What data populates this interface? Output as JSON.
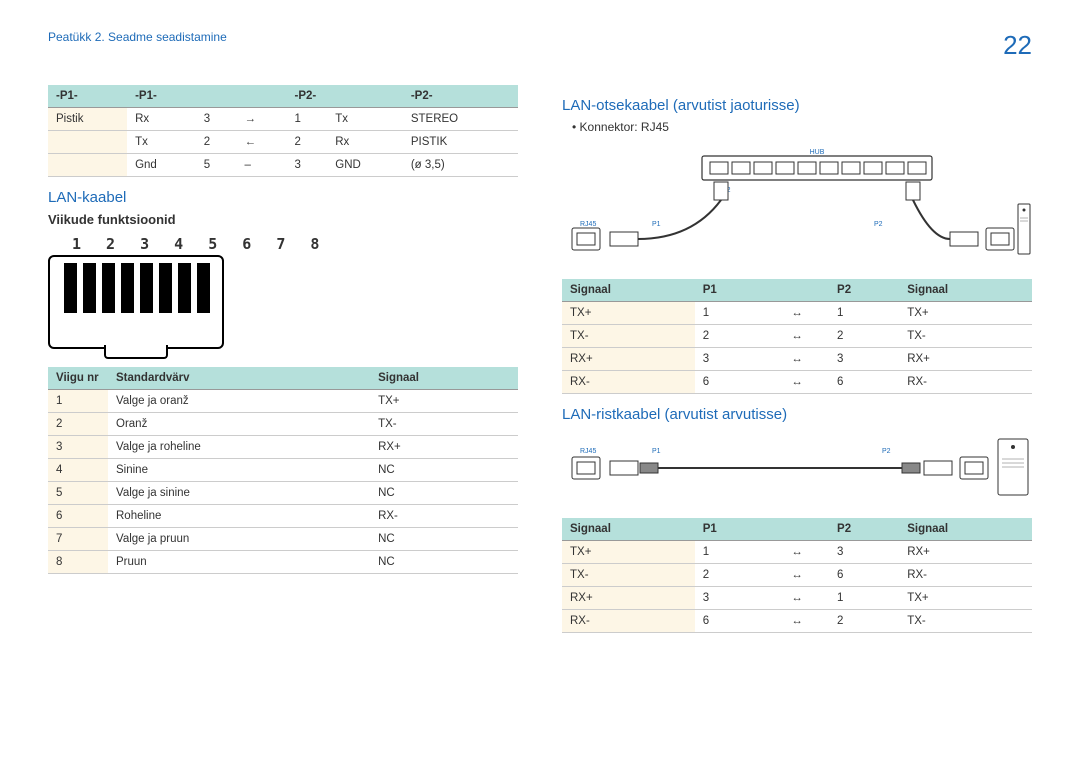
{
  "header": {
    "chapter": "Peatükk 2. Seadme seadistamine",
    "page": "22"
  },
  "left": {
    "table_p1p2": {
      "headers": [
        "-P1-",
        "-P1-",
        "",
        "",
        "-P2-",
        "-P2-"
      ],
      "rows": [
        [
          "Pistik",
          "Rx",
          "3",
          "→",
          "1",
          "Tx",
          "STEREO"
        ],
        [
          "",
          "Tx",
          "2",
          "←",
          "2",
          "Rx",
          "PISTIK"
        ],
        [
          "",
          "Gnd",
          "5",
          "–",
          "3",
          "GND",
          "(ø 3,5)"
        ]
      ]
    },
    "heading_lan": "LAN-kaabel",
    "sub_viikude": "Viikude funktsioonid",
    "pins": "1 2 3 4 5 6 7 8",
    "table_pins": {
      "headers": [
        "Viigu nr",
        "Standardvärv",
        "Signaal"
      ],
      "rows": [
        [
          "1",
          "Valge ja oranž",
          "TX+"
        ],
        [
          "2",
          "Oranž",
          "TX-"
        ],
        [
          "3",
          "Valge ja roheline",
          "RX+"
        ],
        [
          "4",
          "Sinine",
          "NC"
        ],
        [
          "5",
          "Valge ja sinine",
          "NC"
        ],
        [
          "6",
          "Roheline",
          "RX-"
        ],
        [
          "7",
          "Valge ja pruun",
          "NC"
        ],
        [
          "8",
          "Pruun",
          "NC"
        ]
      ]
    }
  },
  "right": {
    "heading_direct": "LAN-otsekaabel (arvutist jaoturisse)",
    "bullet_connector": "Konnektor: RJ45",
    "labels": {
      "hub": "HUB",
      "rj45": "RJ45",
      "p1": "P1",
      "p2": "P2"
    },
    "table_direct": {
      "headers": [
        "Signaal",
        "P1",
        "",
        "P2",
        "Signaal"
      ],
      "rows": [
        [
          "TX+",
          "1",
          "↔",
          "1",
          "TX+"
        ],
        [
          "TX-",
          "2",
          "↔",
          "2",
          "TX-"
        ],
        [
          "RX+",
          "3",
          "↔",
          "3",
          "RX+"
        ],
        [
          "RX-",
          "6",
          "↔",
          "6",
          "RX-"
        ]
      ]
    },
    "heading_cross": "LAN-ristkaabel (arvutist arvutisse)",
    "table_cross": {
      "headers": [
        "Signaal",
        "P1",
        "",
        "P2",
        "Signaal"
      ],
      "rows": [
        [
          "TX+",
          "1",
          "↔",
          "3",
          "RX+"
        ],
        [
          "TX-",
          "2",
          "↔",
          "6",
          "RX-"
        ],
        [
          "RX+",
          "3",
          "↔",
          "1",
          "TX+"
        ],
        [
          "RX-",
          "6",
          "↔",
          "2",
          "TX-"
        ]
      ]
    }
  }
}
